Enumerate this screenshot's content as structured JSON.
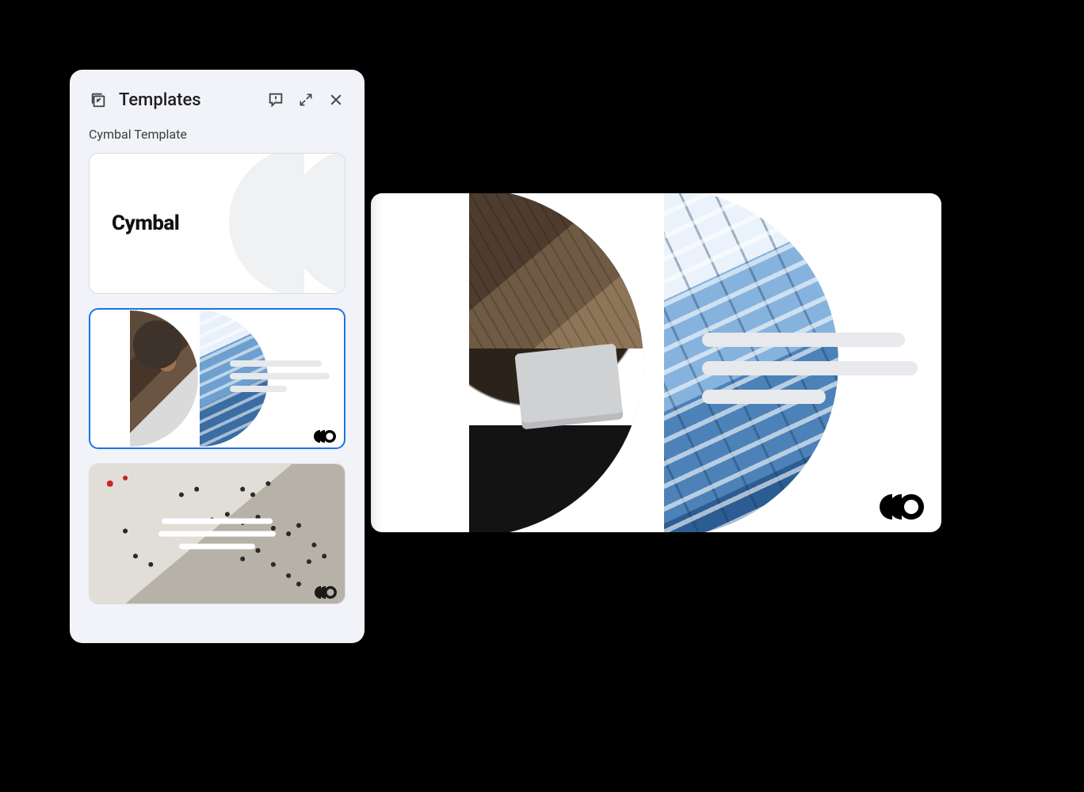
{
  "panel": {
    "title": "Templates",
    "subtitle": "Cymbal Template",
    "icons": {
      "lead": "templates-icon",
      "feedback": "feedback-icon",
      "expand": "expand-icon",
      "close": "close-icon"
    },
    "templates": [
      {
        "id": "title-slide",
        "brand_text": "Cymbal",
        "selected": false
      },
      {
        "id": "content-two-image",
        "selected": true
      },
      {
        "id": "section-header-image",
        "selected": false
      }
    ]
  },
  "preview_slide": {
    "template_id": "content-two-image"
  },
  "brand": {
    "name": "Cymbal",
    "mark": "cymbal-mark"
  },
  "colors": {
    "panel_bg": "#f1f3f8",
    "selected_border": "#1a73e8",
    "placeholder_line": "#e7e9ec"
  }
}
